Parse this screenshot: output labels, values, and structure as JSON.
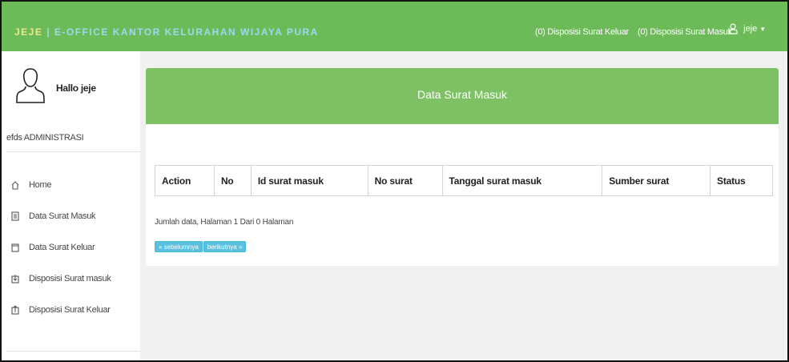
{
  "navbar": {
    "brand_part1": "JEJE",
    "brand_part2": " | E-OFFICE KANTOR KELURAHAN WIJAYA PURA",
    "links": [
      {
        "label": "(0) Disposisi Surat Keluar"
      },
      {
        "label": "(0) Disposisi Surat Masuk"
      }
    ],
    "user": {
      "label": "jeje",
      "icon": "user-icon"
    }
  },
  "sidebar": {
    "greeting": "Hallo jeje",
    "role": "efds ADMINISTRASI",
    "items": [
      {
        "label": "Home",
        "icon": "home-icon"
      },
      {
        "label": "Data Surat Masuk",
        "icon": "inbox-icon"
      },
      {
        "label": "Data Surat Keluar",
        "icon": "outbox-icon"
      },
      {
        "label": "Disposisi Surat masuk",
        "icon": "disposition-in-icon"
      },
      {
        "label": "Disposisi Surat Keluar",
        "icon": "disposition-out-icon"
      }
    ]
  },
  "main": {
    "title": "Data Surat Masuk",
    "table": {
      "columns": [
        "Action",
        "No",
        "Id surat masuk",
        "No surat",
        "Tanggal surat masuk",
        "Sumber surat",
        "Status"
      ],
      "rows": []
    },
    "info": "Jumlah data, Halaman 1 Dari 0 Halaman",
    "pagination": {
      "prev_label": "« sebelumnya",
      "next_label": "berikutnya »"
    }
  },
  "colors": {
    "navbar": "#6cbb58",
    "panel_heading": "#7dc164",
    "pager_button": "#5bc0de",
    "brand_part1": "#ede78c",
    "brand_part2": "#9ed8ef"
  }
}
